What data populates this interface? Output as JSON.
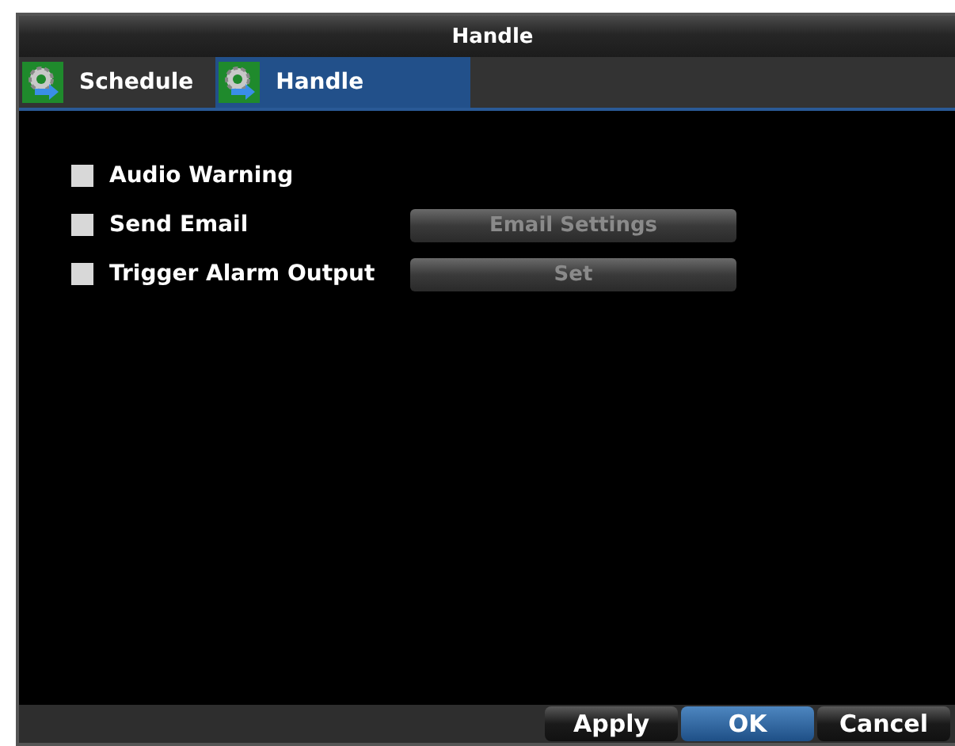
{
  "window": {
    "title": "Handle"
  },
  "tabs": [
    {
      "label": "Schedule",
      "selected": false
    },
    {
      "label": "Handle",
      "selected": true
    }
  ],
  "options": [
    {
      "label": "Audio Warning",
      "checked": false
    },
    {
      "label": "Send Email",
      "checked": false,
      "button": {
        "label": "Email Settings",
        "disabled": true
      }
    },
    {
      "label": "Trigger Alarm Output",
      "checked": false,
      "button": {
        "label": "Set",
        "disabled": true
      }
    }
  ],
  "footer_buttons": [
    {
      "label": "Apply",
      "selected": false
    },
    {
      "label": "OK",
      "selected": true
    },
    {
      "label": "Cancel",
      "selected": false
    }
  ]
}
